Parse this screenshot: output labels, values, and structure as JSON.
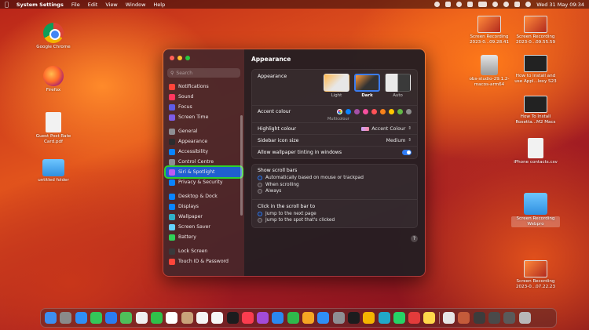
{
  "menubar": {
    "app_name": "System Settings",
    "menus": [
      "File",
      "Edit",
      "View",
      "Window",
      "Help"
    ],
    "clock": "Wed 31 May  09:34"
  },
  "desktop_left": [
    {
      "label": "Google Chrome",
      "icon": "chrome-icon"
    },
    {
      "label": "Firefox",
      "icon": "firefox-icon"
    },
    {
      "label": "Guest Post Rate Card.pdf",
      "icon": "pdf-icon"
    },
    {
      "label": "untitled folder",
      "icon": "folder-icon"
    }
  ],
  "desktop_right": [
    {
      "label": "Screen Recording 2023-0...09.28.41"
    },
    {
      "label": "Screen Recording 2023-0...09.55.59"
    },
    {
      "label": "obs-studio-29.1.2-macos-arm64"
    },
    {
      "label": "How to install and use Appl...lexy S23"
    },
    {
      "label": "How To Install Rosetta...M2 Macs"
    },
    {
      "label": "iPhone contacts.csv"
    },
    {
      "label": "Screen Recording Webpro"
    },
    {
      "label": "Screen Recording 2023-0...07.22.23"
    }
  ],
  "sidebar": {
    "search_placeholder": "Search",
    "groups": [
      [
        {
          "label": "Notifications",
          "color": "#ff453a"
        },
        {
          "label": "Sound",
          "color": "#ff375f"
        },
        {
          "label": "Focus",
          "color": "#5e5ce6"
        },
        {
          "label": "Screen Time",
          "color": "#7d5ce6"
        }
      ],
      [
        {
          "label": "General",
          "color": "#8e8e93"
        },
        {
          "label": "Appearance",
          "color": "#2c2c2e"
        },
        {
          "label": "Accessibility",
          "color": "#0a84ff"
        },
        {
          "label": "Control Centre",
          "color": "#8e8e93"
        },
        {
          "label": "Siri & Spotlight",
          "color": "#bf5af2"
        },
        {
          "label": "Privacy & Security",
          "color": "#0a84ff"
        }
      ],
      [
        {
          "label": "Desktop & Dock",
          "color": "#0a84ff"
        },
        {
          "label": "Displays",
          "color": "#0a84ff"
        },
        {
          "label": "Wallpaper",
          "color": "#30b0c7"
        },
        {
          "label": "Screen Saver",
          "color": "#64d2ff"
        },
        {
          "label": "Battery",
          "color": "#30d158"
        }
      ],
      [
        {
          "label": "Lock Screen",
          "color": "#3a3a3c"
        },
        {
          "label": "Touch ID & Password",
          "color": "#ff453a"
        }
      ]
    ],
    "selected": "Siri & Spotlight"
  },
  "main": {
    "title": "Appearance",
    "appearance_label": "Appearance",
    "themes": [
      "Light",
      "Dark",
      "Auto"
    ],
    "selected_theme": "Dark",
    "accent_label": "Accent colour",
    "accent_colors": [
      "#0a84ff",
      "#a550a7",
      "#f74f9e",
      "#ff5257",
      "#f7821b",
      "#ffc600",
      "#62ba46",
      "#8c8c8c"
    ],
    "multicolour_label": "Multicolour",
    "highlight_label": "Highlight colour",
    "highlight_value": "Accent Colour",
    "sidebar_icon_label": "Sidebar icon size",
    "sidebar_icon_value": "Medium",
    "tinting_label": "Allow wallpaper tinting in windows",
    "tinting_on": true,
    "scroll_bars_label": "Show scroll bars",
    "scroll_bar_options": [
      "Automatically based on mouse or trackpad",
      "When scrolling",
      "Always"
    ],
    "scroll_bar_selected": 0,
    "click_label": "Click in the scroll bar to",
    "click_options": [
      "Jump to the next page",
      "Jump to the spot that's clicked"
    ],
    "click_selected": 0,
    "help": "?"
  },
  "dock": {
    "apps": [
      {
        "icon": "finder-icon",
        "color": "#3d8ef0"
      },
      {
        "icon": "launchpad-icon",
        "color": "#8a8a8a"
      },
      {
        "icon": "safari-icon",
        "color": "#2f8ef5"
      },
      {
        "icon": "messages-icon",
        "color": "#34c759"
      },
      {
        "icon": "mail-icon",
        "color": "#2b7cf0"
      },
      {
        "icon": "maps-icon",
        "color": "#4fbf5a"
      },
      {
        "icon": "photos-icon",
        "color": "#f0f0f0"
      },
      {
        "icon": "facetime-icon",
        "color": "#30c04a"
      },
      {
        "icon": "calendar-icon",
        "color": "#ffffff"
      },
      {
        "icon": "contacts-icon",
        "color": "#c9a27a"
      },
      {
        "icon": "reminders-icon",
        "color": "#f5f5f5"
      },
      {
        "icon": "freeform-icon",
        "color": "#f5f5f5"
      },
      {
        "icon": "tv-icon",
        "color": "#1c1c1e"
      },
      {
        "icon": "music-icon",
        "color": "#fa3c4f"
      },
      {
        "icon": "podcasts-icon",
        "color": "#a34bd8"
      },
      {
        "icon": "keynote-icon",
        "color": "#2b88f0"
      },
      {
        "icon": "numbers-icon",
        "color": "#2fb84c"
      },
      {
        "icon": "pages-icon",
        "color": "#f5a623"
      },
      {
        "icon": "app-store-icon",
        "color": "#2f8ef5"
      },
      {
        "icon": "settings-icon",
        "color": "#8e8e93"
      },
      {
        "icon": "terminal-icon",
        "color": "#1c1c1e"
      },
      {
        "icon": "chrome-icon",
        "color": "#f4b400"
      },
      {
        "icon": "edge-icon",
        "color": "#22a8c9"
      },
      {
        "icon": "whatsapp-icon",
        "color": "#25d366"
      },
      {
        "icon": "screen-recorder-icon",
        "color": "#e33b3b"
      },
      {
        "icon": "notes-icon",
        "color": "#ffd84a"
      }
    ],
    "trailing": [
      {
        "icon": "doc-icon",
        "color": "#e5e5e5"
      },
      {
        "icon": "screenshot-stack-icon",
        "color": "#c45b3a"
      },
      {
        "icon": "folder-stack-icon",
        "color": "#3c3c3c"
      },
      {
        "icon": "downloads-icon",
        "color": "#4a4a4a"
      },
      {
        "icon": "recent-icon",
        "color": "#5a5a5a"
      },
      {
        "icon": "trash-icon",
        "color": "#b8b8b8"
      }
    ]
  }
}
